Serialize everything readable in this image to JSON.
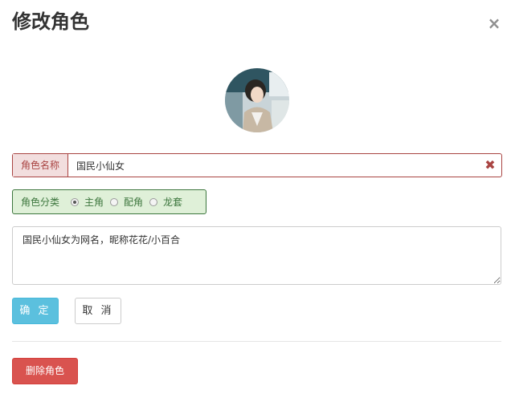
{
  "dialog": {
    "title": "修改角色",
    "close_icon": "close-icon"
  },
  "avatar": {
    "icon": "avatar-photo"
  },
  "name_field": {
    "label": "角色名称",
    "value": "国民小仙女",
    "clear_icon": "clear-x-icon",
    "state_color": "#a94442"
  },
  "category": {
    "label": "角色分类",
    "options": [
      {
        "label": "主角",
        "checked": true
      },
      {
        "label": "配角",
        "checked": false
      },
      {
        "label": "龙套",
        "checked": false
      }
    ],
    "state_color": "#3c763d"
  },
  "description": {
    "value": "国民小仙女为网名，昵称花花/小百合"
  },
  "buttons": {
    "confirm_label": "确 定",
    "cancel_label": "取 消",
    "delete_label": "删除角色"
  },
  "colors": {
    "confirm": "#5bc0de",
    "delete": "#d9534f"
  }
}
